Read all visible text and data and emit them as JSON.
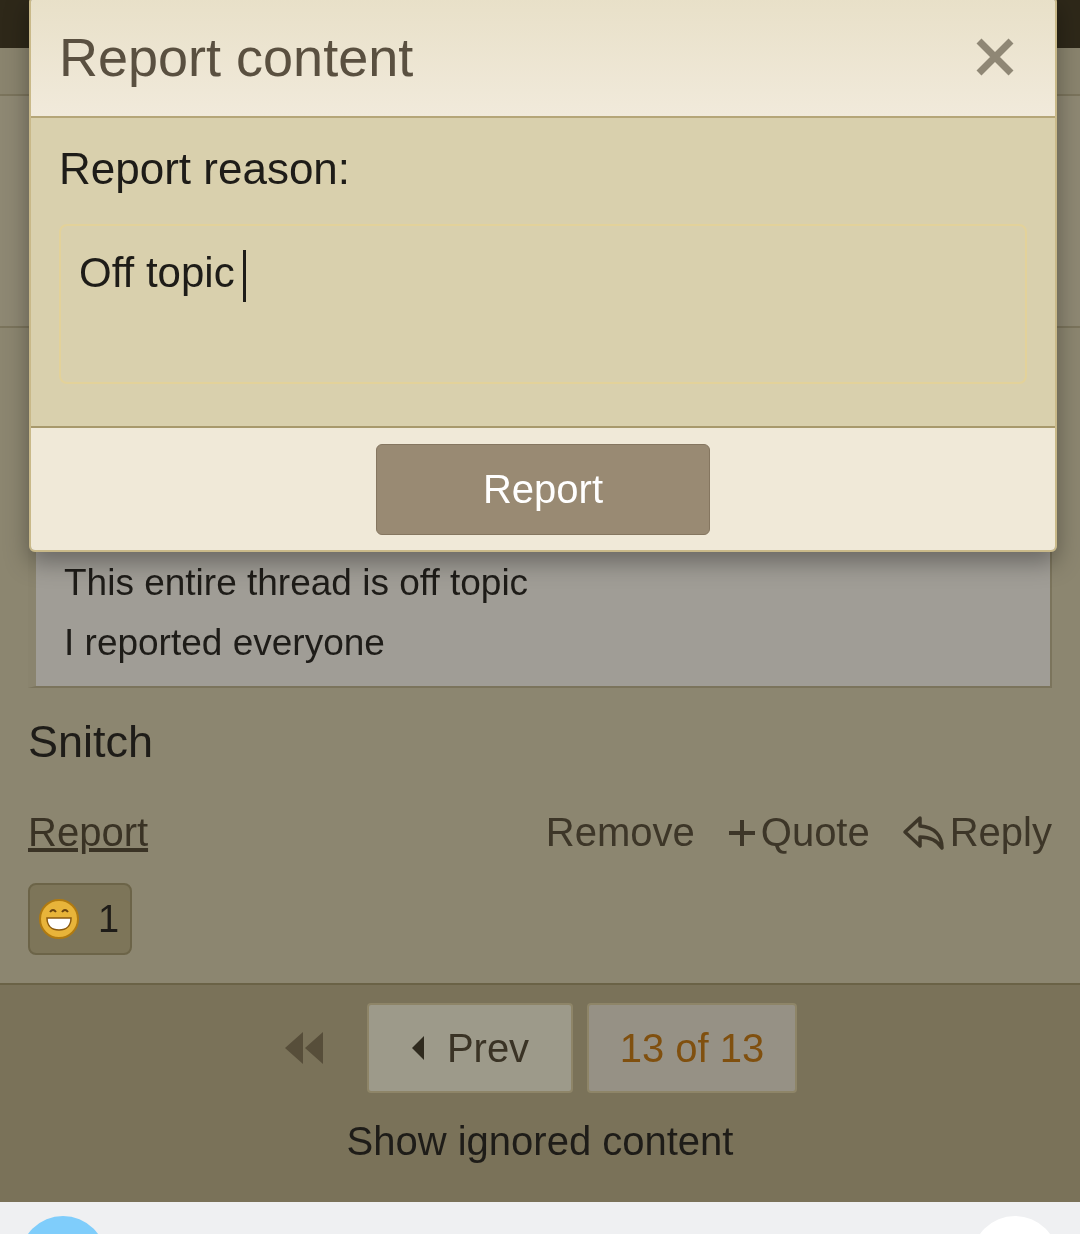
{
  "modal": {
    "title": "Report content",
    "reason_label": "Report reason:",
    "reason_value": "Off topic",
    "submit": "Report"
  },
  "post": {
    "quote_lines": [
      "This entire thread is off topic",
      "I reported everyone"
    ],
    "body": "Snitch",
    "actions": [
      {
        "kind": "link",
        "label": "Report"
      },
      {
        "kind": "plain",
        "label": "Remove"
      },
      {
        "kind": "plus",
        "label": "Quote"
      },
      {
        "kind": "reply",
        "label": "Reply"
      }
    ],
    "reaction": {
      "count": "1"
    }
  },
  "pagination": {
    "prev": "Prev",
    "page": "13 of 13"
  },
  "show_ignored": "Show ignored content"
}
